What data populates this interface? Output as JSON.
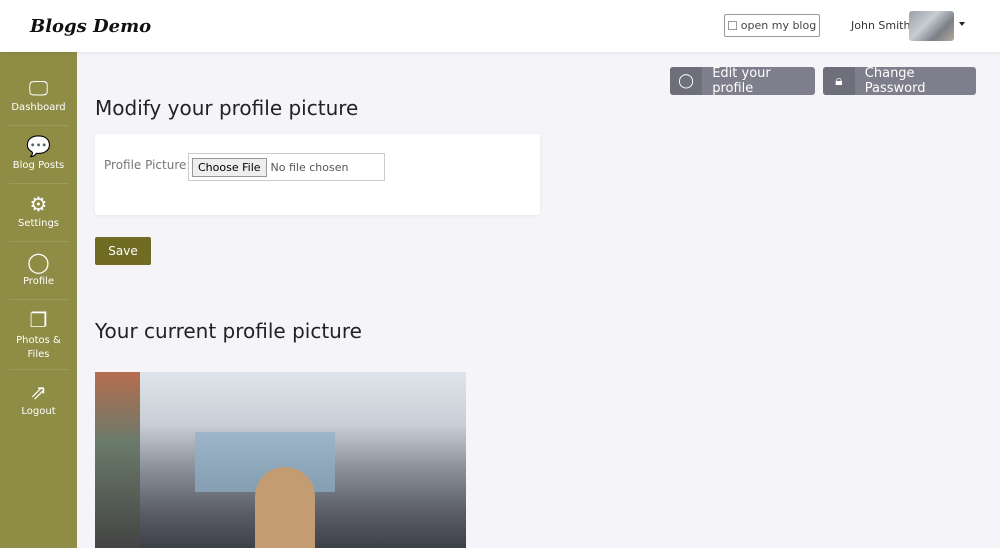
{
  "header": {
    "logo": "Blogs Demo",
    "open_blog": "open my blog",
    "user_name": "John Smith"
  },
  "sidebar": {
    "items": [
      {
        "label": "Dashboard",
        "icon": "monitor-icon"
      },
      {
        "label": "Blog Posts",
        "icon": "chat-icon"
      },
      {
        "label": "Settings",
        "icon": "gear-icon"
      },
      {
        "label": "Profile",
        "icon": "user-icon"
      },
      {
        "label": "Photos & Files",
        "icon": "photos-icon"
      },
      {
        "label": "Logout",
        "icon": "logout-icon"
      }
    ]
  },
  "actions": {
    "edit_profile": "Edit your profile",
    "change_password": "Change Password"
  },
  "main": {
    "title": "Modify your profile picture",
    "field_label": "Profile Picture:",
    "choose_file": "Choose File",
    "no_file": "No file chosen",
    "save": "Save",
    "current_title": "Your current profile picture"
  },
  "colors": {
    "sidebar": "#8f8c45",
    "save": "#716c24",
    "action_buttons": "#7e7e8c"
  }
}
